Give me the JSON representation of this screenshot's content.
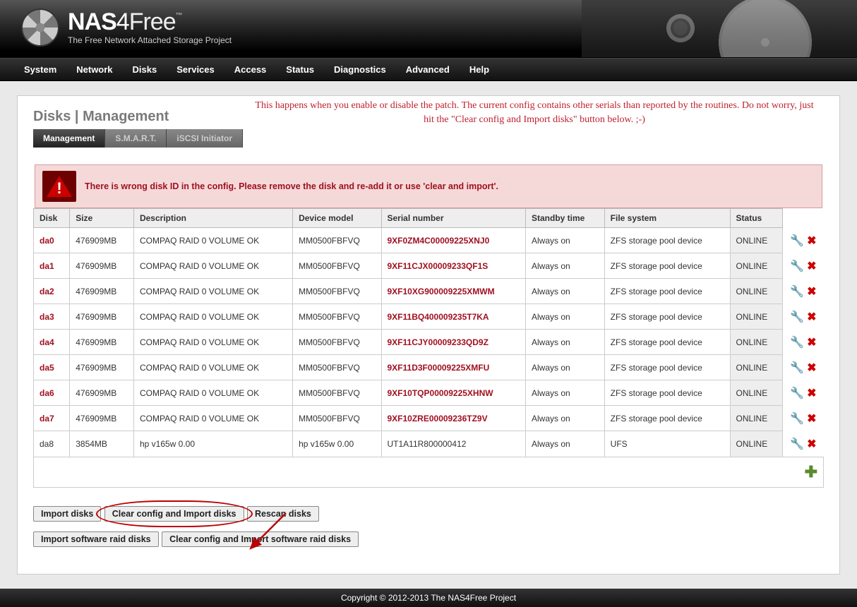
{
  "brand": {
    "nas": "NAS",
    "four": "4",
    "free": "Free",
    "tm": "™",
    "tagline": "The Free Network Attached Storage Project"
  },
  "menu": [
    "System",
    "Network",
    "Disks",
    "Services",
    "Access",
    "Status",
    "Diagnostics",
    "Advanced",
    "Help"
  ],
  "page": {
    "title": "Disks | Management"
  },
  "tabs": [
    {
      "label": "Management",
      "active": true
    },
    {
      "label": "S.M.A.R.T.",
      "active": false
    },
    {
      "label": "iSCSI Initiator",
      "active": false
    }
  ],
  "overlay_note": "This happens when you enable or disable the patch. The current config contains other serials than reported by the routines. Do not worry, just hit the \"Clear config and Import disks\" button below. ;-)",
  "alert": "There is wrong disk ID in the config. Please remove the disk and re-add it or use 'clear and import'.",
  "columns": [
    "Disk",
    "Size",
    "Description",
    "Device model",
    "Serial number",
    "Standby time",
    "File system",
    "Status"
  ],
  "disks": [
    {
      "disk": "da0",
      "size": "476909MB",
      "desc": "COMPAQ RAID 0 VOLUME OK",
      "model": "MM0500FBFVQ",
      "serial": "9XF0ZM4C00009225XNJ0",
      "standby": "Always on",
      "fs": "ZFS storage pool device",
      "status": "ONLINE",
      "warn": true
    },
    {
      "disk": "da1",
      "size": "476909MB",
      "desc": "COMPAQ RAID 0 VOLUME OK",
      "model": "MM0500FBFVQ",
      "serial": "9XF11CJX00009233QF1S",
      "standby": "Always on",
      "fs": "ZFS storage pool device",
      "status": "ONLINE",
      "warn": true
    },
    {
      "disk": "da2",
      "size": "476909MB",
      "desc": "COMPAQ RAID 0 VOLUME OK",
      "model": "MM0500FBFVQ",
      "serial": "9XF10XG900009225XMWM",
      "standby": "Always on",
      "fs": "ZFS storage pool device",
      "status": "ONLINE",
      "warn": true
    },
    {
      "disk": "da3",
      "size": "476909MB",
      "desc": "COMPAQ RAID 0 VOLUME OK",
      "model": "MM0500FBFVQ",
      "serial": "9XF11BQ400009235T7KA",
      "standby": "Always on",
      "fs": "ZFS storage pool device",
      "status": "ONLINE",
      "warn": true
    },
    {
      "disk": "da4",
      "size": "476909MB",
      "desc": "COMPAQ RAID 0 VOLUME OK",
      "model": "MM0500FBFVQ",
      "serial": "9XF11CJY00009233QD9Z",
      "standby": "Always on",
      "fs": "ZFS storage pool device",
      "status": "ONLINE",
      "warn": true
    },
    {
      "disk": "da5",
      "size": "476909MB",
      "desc": "COMPAQ RAID 0 VOLUME OK",
      "model": "MM0500FBFVQ",
      "serial": "9XF11D3F00009225XMFU",
      "standby": "Always on",
      "fs": "ZFS storage pool device",
      "status": "ONLINE",
      "warn": true
    },
    {
      "disk": "da6",
      "size": "476909MB",
      "desc": "COMPAQ RAID 0 VOLUME OK",
      "model": "MM0500FBFVQ",
      "serial": "9XF10TQP00009225XHNW",
      "standby": "Always on",
      "fs": "ZFS storage pool device",
      "status": "ONLINE",
      "warn": true
    },
    {
      "disk": "da7",
      "size": "476909MB",
      "desc": "COMPAQ RAID 0 VOLUME OK",
      "model": "MM0500FBFVQ",
      "serial": "9XF10ZRE00009236TZ9V",
      "standby": "Always on",
      "fs": "ZFS storage pool device",
      "status": "ONLINE",
      "warn": true
    },
    {
      "disk": "da8",
      "size": "3854MB",
      "desc": "hp v165w 0.00",
      "model": "hp v165w 0.00",
      "serial": "UT1A11R800000412",
      "standby": "Always on",
      "fs": "UFS",
      "status": "ONLINE",
      "warn": false
    }
  ],
  "buttons": {
    "import": "Import disks",
    "clear_import": "Clear config and Import disks",
    "rescan": "Rescan disks",
    "import_raid": "Import software raid disks",
    "clear_import_raid": "Clear config and Import software raid disks"
  },
  "footer": "Copyright © 2012-2013 The NAS4Free Project"
}
